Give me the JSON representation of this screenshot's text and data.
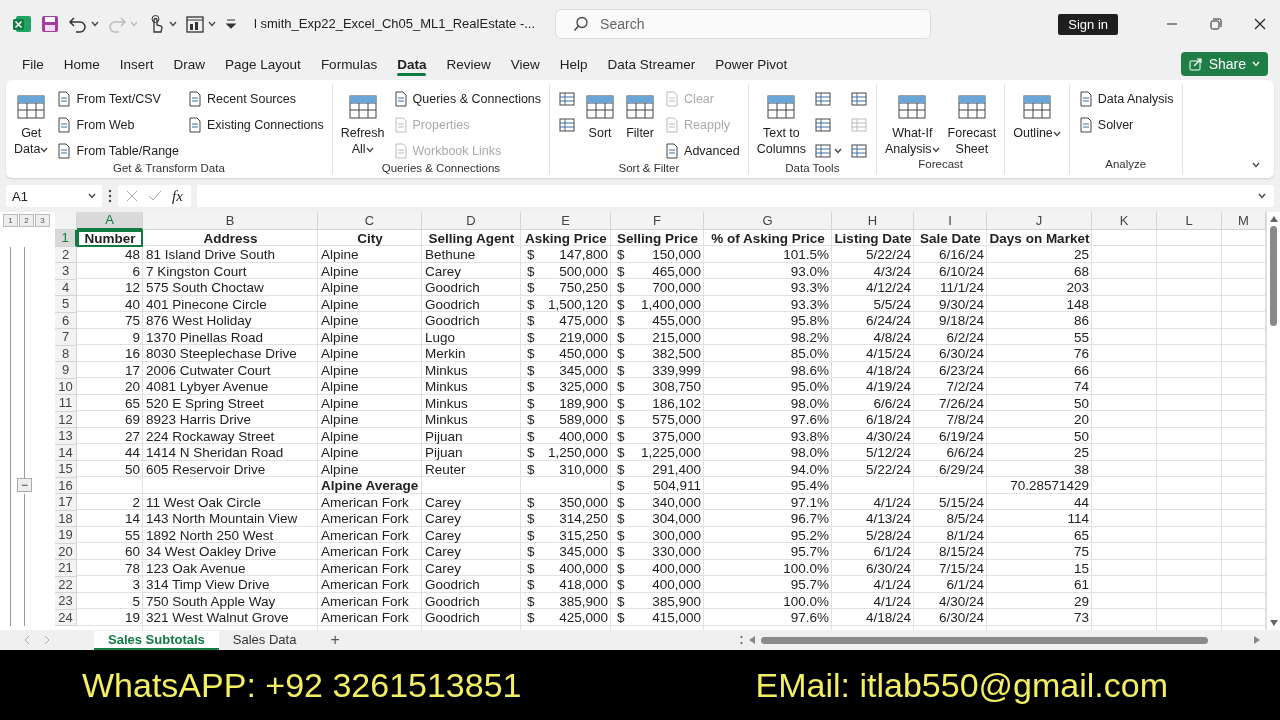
{
  "title_bar": {
    "title": "l smith_Exp22_Excel_Ch05_ML1_RealEstate  -...",
    "search": {
      "placeholder": "Search"
    },
    "sign_in": "Sign in"
  },
  "tabs": [
    {
      "label": "File",
      "selected": false
    },
    {
      "label": "Home",
      "selected": false
    },
    {
      "label": "Insert",
      "selected": false
    },
    {
      "label": "Draw",
      "selected": false
    },
    {
      "label": "Page Layout",
      "selected": false
    },
    {
      "label": "Formulas",
      "selected": false
    },
    {
      "label": "Data",
      "selected": true
    },
    {
      "label": "Review",
      "selected": false
    },
    {
      "label": "View",
      "selected": false
    },
    {
      "label": "Help",
      "selected": false
    },
    {
      "label": "Data Streamer",
      "selected": false
    },
    {
      "label": "Power Pivot",
      "selected": false
    }
  ],
  "share": "Share",
  "ribbon": [
    {
      "label": "Get & Transform Data",
      "columns": [
        [
          {
            "kind": "large",
            "label": "Get\nData",
            "dropdown": true,
            "disabled": false
          }
        ],
        [
          {
            "kind": "small",
            "label": "From Text/CSV",
            "dropdown": false,
            "disabled": false
          },
          {
            "kind": "small",
            "label": "From Web",
            "dropdown": false,
            "disabled": false
          },
          {
            "kind": "small",
            "label": "From Table/Range",
            "dropdown": false,
            "disabled": false
          }
        ],
        [
          {
            "kind": "small",
            "label": "Recent Sources",
            "dropdown": false,
            "disabled": false
          },
          {
            "kind": "small",
            "label": "Existing Connections",
            "dropdown": false,
            "disabled": false
          }
        ]
      ]
    },
    {
      "label": "Queries & Connections",
      "columns": [
        [
          {
            "kind": "large",
            "label": "Refresh\nAll",
            "dropdown": true,
            "disabled": false
          }
        ],
        [
          {
            "kind": "small",
            "label": "Queries & Connections",
            "dropdown": false,
            "disabled": false
          },
          {
            "kind": "small",
            "label": "Properties",
            "dropdown": false,
            "disabled": true
          },
          {
            "kind": "small",
            "label": "Workbook Links",
            "dropdown": false,
            "disabled": true
          }
        ]
      ]
    },
    {
      "label": "Sort & Filter",
      "columns": [
        [
          {
            "kind": "icon",
            "dropdown": false,
            "disabled": false
          },
          {
            "kind": "icon",
            "dropdown": false,
            "disabled": false
          }
        ],
        [
          {
            "kind": "large",
            "label": "Sort",
            "dropdown": false,
            "disabled": false
          }
        ],
        [
          {
            "kind": "large",
            "label": "Filter",
            "dropdown": false,
            "disabled": false
          }
        ],
        [
          {
            "kind": "small",
            "label": "Clear",
            "dropdown": false,
            "disabled": true
          },
          {
            "kind": "small",
            "label": "Reapply",
            "dropdown": false,
            "disabled": true
          },
          {
            "kind": "small",
            "label": "Advanced",
            "dropdown": false,
            "disabled": false
          }
        ]
      ]
    },
    {
      "label": "Data Tools",
      "columns": [
        [
          {
            "kind": "large",
            "label": "Text to\nColumns",
            "dropdown": false,
            "disabled": false
          }
        ],
        [
          {
            "kind": "icon",
            "dropdown": false,
            "disabled": false
          },
          {
            "kind": "icon",
            "dropdown": false,
            "disabled": false
          },
          {
            "kind": "icon",
            "dropdown": true,
            "disabled": false
          }
        ],
        [
          {
            "kind": "icon",
            "dropdown": false,
            "disabled": false
          },
          {
            "kind": "icon",
            "dropdown": false,
            "disabled": true
          },
          {
            "kind": "icon",
            "dropdown": false,
            "disabled": false
          }
        ]
      ]
    },
    {
      "label": "Forecast",
      "columns": [
        [
          {
            "kind": "large",
            "label": "What-If\nAnalysis",
            "dropdown": true,
            "disabled": false
          }
        ],
        [
          {
            "kind": "large",
            "label": "Forecast\nSheet",
            "dropdown": false,
            "disabled": false
          }
        ]
      ]
    },
    {
      "columns": [
        [
          {
            "kind": "large",
            "label": "Outline",
            "dropdown": true,
            "disabled": false
          }
        ]
      ]
    },
    {
      "label": "Analyze",
      "columns": [
        [
          {
            "kind": "small",
            "label": "Data Analysis",
            "dropdown": false,
            "disabled": false
          },
          {
            "kind": "small",
            "label": "Solver",
            "dropdown": false,
            "disabled": false
          }
        ]
      ]
    }
  ],
  "formula_bar": {
    "name_box": "A1",
    "fx": "fx"
  },
  "sheet": {
    "outline_levels": [
      "1",
      "2",
      "3"
    ],
    "collapse": "−",
    "columns": [
      {
        "letter": "A",
        "selected": true
      },
      {
        "letter": "B",
        "selected": false
      },
      {
        "letter": "C",
        "selected": false
      },
      {
        "letter": "D",
        "selected": false
      },
      {
        "letter": "E",
        "selected": false
      },
      {
        "letter": "F",
        "selected": false
      },
      {
        "letter": "G",
        "selected": false
      },
      {
        "letter": "H",
        "selected": false
      },
      {
        "letter": "I",
        "selected": false
      },
      {
        "letter": "J",
        "selected": false
      },
      {
        "letter": "K",
        "selected": false
      },
      {
        "letter": "L",
        "selected": false
      },
      {
        "letter": "M",
        "selected": false
      }
    ],
    "rows": [
      {
        "n": "1",
        "kind": "header",
        "selected": true,
        "cells": [
          "Number",
          "Address",
          "City",
          "Selling Agent",
          "Asking Price",
          "Selling Price",
          "% of Asking Price",
          "Listing Date",
          "Sale Date",
          "Days on Market"
        ]
      },
      {
        "n": "2",
        "kind": "data",
        "selected": false,
        "cells": [
          "48",
          "81 Island Drive South",
          "Alpine",
          "Bethune",
          [
            "$",
            "147,800"
          ],
          [
            "$",
            "150,000"
          ],
          "101.5%",
          "5/22/24",
          "6/16/24",
          "25"
        ]
      },
      {
        "n": "3",
        "kind": "data",
        "selected": false,
        "cells": [
          "6",
          "7 Kingston Court",
          "Alpine",
          "Carey",
          [
            "$",
            "500,000"
          ],
          [
            "$",
            "465,000"
          ],
          "93.0%",
          "4/3/24",
          "6/10/24",
          "68"
        ]
      },
      {
        "n": "4",
        "kind": "data",
        "selected": false,
        "cells": [
          "12",
          "575 South Choctaw",
          "Alpine",
          "Goodrich",
          [
            "$",
            "750,250"
          ],
          [
            "$",
            "700,000"
          ],
          "93.3%",
          "4/12/24",
          "11/1/24",
          "203"
        ]
      },
      {
        "n": "5",
        "kind": "data",
        "selected": false,
        "cells": [
          "40",
          "401 Pinecone Circle",
          "Alpine",
          "Goodrich",
          [
            "$",
            "1,500,120"
          ],
          [
            "$",
            "1,400,000"
          ],
          "93.3%",
          "5/5/24",
          "9/30/24",
          "148"
        ]
      },
      {
        "n": "6",
        "kind": "data",
        "selected": false,
        "cells": [
          "75",
          "876 West Holiday",
          "Alpine",
          "Goodrich",
          [
            "$",
            "475,000"
          ],
          [
            "$",
            "455,000"
          ],
          "95.8%",
          "6/24/24",
          "9/18/24",
          "86"
        ]
      },
      {
        "n": "7",
        "kind": "data",
        "selected": false,
        "cells": [
          "9",
          "1370 Pinellas Road",
          "Alpine",
          "Lugo",
          [
            "$",
            "219,000"
          ],
          [
            "$",
            "215,000"
          ],
          "98.2%",
          "4/8/24",
          "6/2/24",
          "55"
        ]
      },
      {
        "n": "8",
        "kind": "data",
        "selected": false,
        "cells": [
          "16",
          "8030 Steeplechase Drive",
          "Alpine",
          "Merkin",
          [
            "$",
            "450,000"
          ],
          [
            "$",
            "382,500"
          ],
          "85.0%",
          "4/15/24",
          "6/30/24",
          "76"
        ]
      },
      {
        "n": "9",
        "kind": "data",
        "selected": false,
        "cells": [
          "17",
          "2006 Cutwater Court",
          "Alpine",
          "Minkus",
          [
            "$",
            "345,000"
          ],
          [
            "$",
            "339,999"
          ],
          "98.6%",
          "4/18/24",
          "6/23/24",
          "66"
        ]
      },
      {
        "n": "10",
        "kind": "data",
        "selected": false,
        "cells": [
          "20",
          "4081 Lybyer Avenue",
          "Alpine",
          "Minkus",
          [
            "$",
            "325,000"
          ],
          [
            "$",
            "308,750"
          ],
          "95.0%",
          "4/19/24",
          "7/2/24",
          "74"
        ]
      },
      {
        "n": "11",
        "kind": "data",
        "selected": false,
        "cells": [
          "65",
          "520 E Spring Street",
          "Alpine",
          "Minkus",
          [
            "$",
            "189,900"
          ],
          [
            "$",
            "186,102"
          ],
          "98.0%",
          "6/6/24",
          "7/26/24",
          "50"
        ]
      },
      {
        "n": "12",
        "kind": "data",
        "selected": false,
        "cells": [
          "69",
          "8923 Harris Drive",
          "Alpine",
          "Minkus",
          [
            "$",
            "589,000"
          ],
          [
            "$",
            "575,000"
          ],
          "97.6%",
          "6/18/24",
          "7/8/24",
          "20"
        ]
      },
      {
        "n": "13",
        "kind": "data",
        "selected": false,
        "cells": [
          "27",
          "224 Rockaway Street",
          "Alpine",
          "Pijuan",
          [
            "$",
            "400,000"
          ],
          [
            "$",
            "375,000"
          ],
          "93.8%",
          "4/30/24",
          "6/19/24",
          "50"
        ]
      },
      {
        "n": "14",
        "kind": "data",
        "selected": false,
        "cells": [
          "44",
          "1414 N Sheridan Road",
          "Alpine",
          "Pijuan",
          [
            "$",
            "1,250,000"
          ],
          [
            "$",
            "1,225,000"
          ],
          "98.0%",
          "5/12/24",
          "6/6/24",
          "25"
        ]
      },
      {
        "n": "15",
        "kind": "data",
        "selected": false,
        "cells": [
          "50",
          "605 Reservoir Drive",
          "Alpine",
          "Reuter",
          [
            "$",
            "310,000"
          ],
          [
            "$",
            "291,400"
          ],
          "94.0%",
          "5/22/24",
          "6/29/24",
          "38"
        ]
      },
      {
        "n": "16",
        "kind": "subtotal",
        "selected": false,
        "cells": [
          null,
          null,
          "Alpine Average",
          null,
          null,
          [
            "$",
            "504,911"
          ],
          "95.4%",
          null,
          null,
          "70.28571429"
        ]
      },
      {
        "n": "17",
        "kind": "data",
        "selected": false,
        "cells": [
          "2",
          "11 West Oak Circle",
          "American Fork",
          "Carey",
          [
            "$",
            "350,000"
          ],
          [
            "$",
            "340,000"
          ],
          "97.1%",
          "4/1/24",
          "5/15/24",
          "44"
        ]
      },
      {
        "n": "18",
        "kind": "data",
        "selected": false,
        "cells": [
          "14",
          "143 North Mountain View",
          "American Fork",
          "Carey",
          [
            "$",
            "314,250"
          ],
          [
            "$",
            "304,000"
          ],
          "96.7%",
          "4/13/24",
          "8/5/24",
          "114"
        ]
      },
      {
        "n": "19",
        "kind": "data",
        "selected": false,
        "cells": [
          "55",
          "1892 North 250 West",
          "American Fork",
          "Carey",
          [
            "$",
            "315,250"
          ],
          [
            "$",
            "300,000"
          ],
          "95.2%",
          "5/28/24",
          "8/1/24",
          "65"
        ]
      },
      {
        "n": "20",
        "kind": "data",
        "selected": false,
        "cells": [
          "60",
          "34 West Oakley Drive",
          "American Fork",
          "Carey",
          [
            "$",
            "345,000"
          ],
          [
            "$",
            "330,000"
          ],
          "95.7%",
          "6/1/24",
          "8/15/24",
          "75"
        ]
      },
      {
        "n": "21",
        "kind": "data",
        "selected": false,
        "cells": [
          "78",
          "123 Oak Avenue",
          "American Fork",
          "Carey",
          [
            "$",
            "400,000"
          ],
          [
            "$",
            "400,000"
          ],
          "100.0%",
          "6/30/24",
          "7/15/24",
          "15"
        ]
      },
      {
        "n": "22",
        "kind": "data",
        "selected": false,
        "cells": [
          "3",
          "314 Timp View Drive",
          "American Fork",
          "Goodrich",
          [
            "$",
            "418,000"
          ],
          [
            "$",
            "400,000"
          ],
          "95.7%",
          "4/1/24",
          "6/1/24",
          "61"
        ]
      },
      {
        "n": "23",
        "kind": "data",
        "selected": false,
        "cells": [
          "5",
          "750 South Apple Way",
          "American Fork",
          "Goodrich",
          [
            "$",
            "385,900"
          ],
          [
            "$",
            "385,900"
          ],
          "100.0%",
          "4/1/24",
          "4/30/24",
          "29"
        ]
      },
      {
        "n": "24",
        "kind": "data",
        "selected": false,
        "cells": [
          "19",
          "321 West Walnut Grove",
          "American Fork",
          "Goodrich",
          [
            "$",
            "425,000"
          ],
          [
            "$",
            "415,000"
          ],
          "97.6%",
          "4/18/24",
          "6/30/24",
          "73"
        ]
      }
    ]
  },
  "sheet_tabs": {
    "tabs": [
      {
        "label": "Sales Subtotals",
        "selected": true
      },
      {
        "label": "Sales Data",
        "selected": false
      }
    ],
    "add": "+"
  },
  "banner": [
    "WhatsAPP: +92 3261513851",
    "EMail: itlab550@gmail.com"
  ]
}
